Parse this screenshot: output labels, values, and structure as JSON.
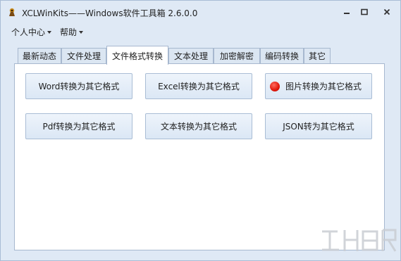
{
  "window": {
    "title": "XCLWinKits——Windows软件工具箱 2.6.0.0",
    "controls": [
      "minimize-icon",
      "maximize-icon",
      "close-icon"
    ]
  },
  "menu": {
    "items": [
      {
        "label": "个人中心"
      },
      {
        "label": "帮助"
      }
    ]
  },
  "tabs": [
    {
      "label": "最新动态",
      "active": false
    },
    {
      "label": "文件处理",
      "active": false
    },
    {
      "label": "文件格式转换",
      "active": true
    },
    {
      "label": "文本处理",
      "active": false
    },
    {
      "label": "加密解密",
      "active": false
    },
    {
      "label": "编码转换",
      "active": false
    },
    {
      "label": "其它",
      "active": false
    }
  ],
  "buttons": [
    {
      "label": "Word转换为其它格式"
    },
    {
      "label": "Excel转换为其它格式"
    },
    {
      "label": "图片转换为其它格式",
      "icon": "red-circle-icon"
    },
    {
      "label": "Pdf转换为其它格式"
    },
    {
      "label": "文本转换为其它格式"
    },
    {
      "label": "JSON转为其它格式"
    }
  ],
  "colors": {
    "window_bg": "#dfe9f5",
    "panel_bg": "#ffffff",
    "button_border": "#a9bdd5",
    "accent_red": "#e0180c"
  }
}
